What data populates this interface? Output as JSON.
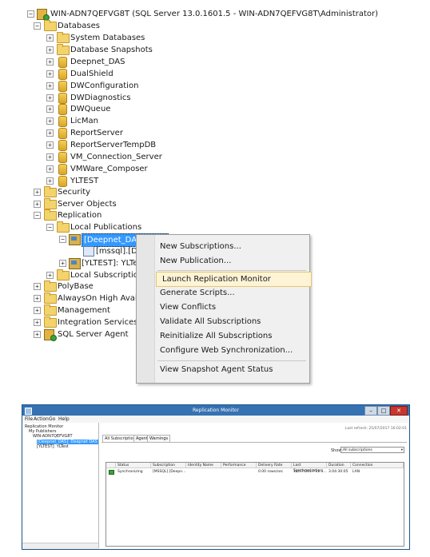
{
  "object_explorer": {
    "server": "WIN-ADN7QEFVG8T (SQL Server 13.0.1601.5 - WIN-ADN7QEFVG8T\\Administrator)",
    "databases_label": "Databases",
    "databases": [
      "System Databases",
      "Database Snapshots",
      "Deepnet_DAS",
      "DualShield",
      "DWConfiguration",
      "DWDiagnostics",
      "DWQueue",
      "LicMan",
      "ReportServer",
      "ReportServerTempDB",
      "VM_Connection_Server",
      "VMWare_Composer",
      "YLTEST"
    ],
    "security": "Security",
    "server_objects": "Server Objects",
    "replication": "Replication",
    "local_publications": "Local Publications",
    "pub1": "[Deepnet_DAS]: Dee",
    "pub1_sub": "[mssql].[Dee",
    "pub2": "[YLTEST]: YLTes",
    "local_subscriptions": "Local Subscriptions",
    "polybase": "PolyBase",
    "alwayson": "AlwaysOn High Availal",
    "management": "Management",
    "integration": "Integration Services Ca",
    "agent": "SQL Server Agent"
  },
  "context_menu": {
    "items": [
      "New Subscriptions...",
      "New Publication...",
      "Launch Replication Monitor",
      "Generate Scripts...",
      "View Conflicts",
      "Validate All Subscriptions",
      "Reinitialize All Subscriptions",
      "Configure Web Synchronization...",
      "View Snapshot Agent Status"
    ],
    "highlighted": "Launch Replication Monitor"
  },
  "monitor": {
    "title": "Replication Monitor",
    "menu": [
      "File",
      "Action",
      "Go",
      "Help"
    ],
    "last_refresh": "Last refresh: 25/07/2017 16:02:01",
    "tree": [
      "Replication Monitor",
      "My Publishers",
      "WIN-ADN7QEFVG8T",
      "[Deepnet_DAS]: Deepnet DAS",
      "[YLTEST]: YLTest"
    ],
    "tabs": [
      "All Subscriptions",
      "Agents",
      "Warnings"
    ],
    "show_label": "Show:",
    "show_value": "All subscriptions",
    "columns": [
      "Status",
      "Subscription",
      "Identity Name",
      "Performance",
      "Delivery Rate",
      "Last Synchronization",
      "Duration",
      "Connection"
    ],
    "row": [
      "Synchronizing",
      "[MSSQL].[Deepn...",
      "",
      "",
      "0.00 rows/sec",
      "18/07/2017 11:3...",
      "3.04:30:05",
      "LAN"
    ]
  },
  "colors": {
    "accent": "#3399ff",
    "menu_highlight": "#fdf4d6",
    "titlebar": "#3671b2"
  }
}
